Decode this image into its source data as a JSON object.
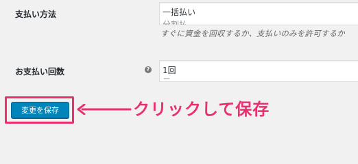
{
  "payment_method": {
    "label": "支払い方法",
    "selected": "一括払い",
    "next_option": "分割払",
    "description": "すぐに資金を回収するか、支払いのみを許可するか"
  },
  "payment_count": {
    "label": "お支払い回数",
    "help_icon": "?",
    "selected": "1回",
    "next_option": "二"
  },
  "save_button_label": "変更を保存",
  "annotation": {
    "text": "クリックして保存",
    "color": "#e9306d"
  },
  "colors": {
    "button": "#0085ba",
    "background": "#f1f1f1"
  }
}
